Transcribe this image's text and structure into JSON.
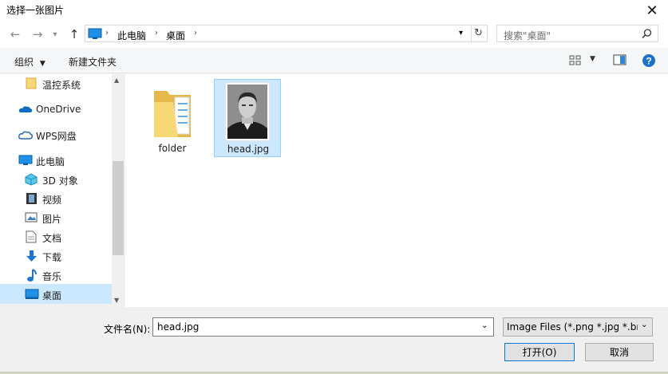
{
  "window": {
    "title": "选择一张图片"
  },
  "address": {
    "crumbs": [
      "此电脑",
      "桌面"
    ]
  },
  "search": {
    "placeholder": "搜索\"桌面\""
  },
  "toolbar": {
    "organize": "组织",
    "new_folder": "新建文件夹"
  },
  "nav": {
    "items": [
      {
        "label": "温控系统",
        "icon": "folder-icon"
      },
      {
        "label": "OneDrive",
        "icon": "onedrive-icon"
      },
      {
        "label": "WPS网盘",
        "icon": "wps-cloud-icon"
      },
      {
        "label": "此电脑",
        "icon": "this-pc-icon"
      },
      {
        "label": "3D 对象",
        "icon": "3d-objects-icon"
      },
      {
        "label": "视频",
        "icon": "video-icon"
      },
      {
        "label": "图片",
        "icon": "pictures-icon"
      },
      {
        "label": "文档",
        "icon": "documents-icon"
      },
      {
        "label": "下载",
        "icon": "downloads-icon"
      },
      {
        "label": "音乐",
        "icon": "music-icon"
      },
      {
        "label": "桌面",
        "icon": "desktop-icon",
        "selected": true
      }
    ]
  },
  "files": [
    {
      "name": "folder",
      "type": "folder"
    },
    {
      "name": "head.jpg",
      "type": "image",
      "selected": true
    }
  ],
  "bottom": {
    "filename_label": "文件名(N):",
    "filename_value": "head.jpg",
    "filetype": "Image Files (*.png *.jpg *.bmp)",
    "open": "打开(O)",
    "cancel": "取消"
  },
  "colors": {
    "accent": "#0078d7",
    "selection": "#cce8ff",
    "selection_border": "#99d1ff"
  }
}
